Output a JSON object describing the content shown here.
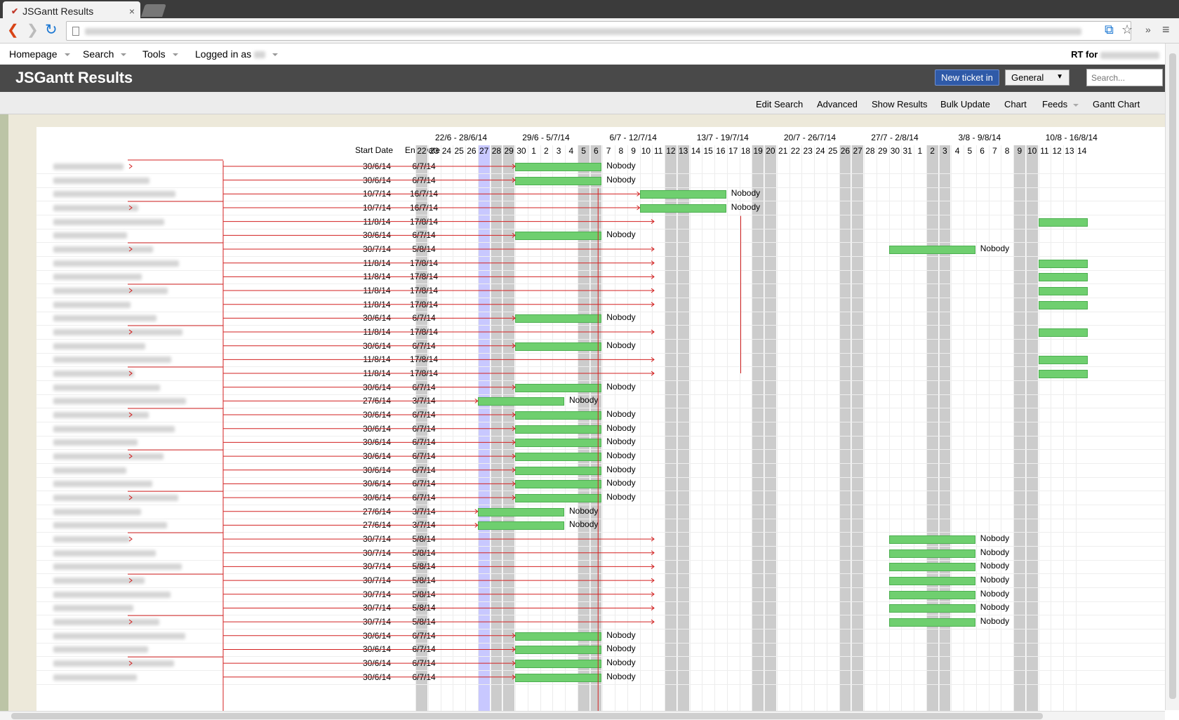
{
  "browser": {
    "tab_title": "JSGantt Results",
    "tab_close": "×"
  },
  "rt_menu": {
    "homepage": "Homepage",
    "search": "Search",
    "tools": "Tools",
    "logged_in": "Logged in as",
    "rt_for": "RT for"
  },
  "header": {
    "title": "JSGantt Results",
    "new_ticket": "New ticket in",
    "queue": "General",
    "search_placeholder": "Search..."
  },
  "page_menu": [
    "Edit Search",
    "Advanced",
    "Show Results",
    "Bulk Update",
    "Chart",
    "Feeds",
    "Gantt Chart"
  ],
  "gantt": {
    "start_header": "Start Date",
    "end_header": "End Date",
    "weeks": [
      "22/6 - 28/6/14",
      "29/6 - 5/7/14",
      "6/7 - 12/7/14",
      "13/7 - 19/7/14",
      "20/7 - 26/7/14",
      "27/7 - 2/8/14",
      "3/8 - 9/8/14",
      "10/8 - 16/8/14"
    ],
    "days": [
      "22",
      "23",
      "24",
      "25",
      "26",
      "27",
      "28",
      "29",
      "30",
      "1",
      "2",
      "3",
      "4",
      "5",
      "6",
      "7",
      "8",
      "9",
      "10",
      "11",
      "12",
      "13",
      "14",
      "15",
      "16",
      "17",
      "18",
      "19",
      "20",
      "21",
      "22",
      "23",
      "24",
      "25",
      "26",
      "27",
      "28",
      "29",
      "30",
      "31",
      "1",
      "2",
      "3",
      "4",
      "5",
      "6",
      "7",
      "8",
      "9",
      "10",
      "11",
      "12",
      "13",
      "14"
    ],
    "resource": "Nobody",
    "rows": [
      {
        "start": "30/6/14",
        "end": "6/7/14"
      },
      {
        "start": "30/6/14",
        "end": "6/7/14"
      },
      {
        "start": "10/7/14",
        "end": "16/7/14"
      },
      {
        "start": "10/7/14",
        "end": "16/7/14"
      },
      {
        "start": "11/8/14",
        "end": "17/8/14"
      },
      {
        "start": "30/6/14",
        "end": "6/7/14"
      },
      {
        "start": "30/7/14",
        "end": "5/8/14"
      },
      {
        "start": "11/8/14",
        "end": "17/8/14"
      },
      {
        "start": "11/8/14",
        "end": "17/8/14"
      },
      {
        "start": "11/8/14",
        "end": "17/8/14"
      },
      {
        "start": "11/8/14",
        "end": "17/8/14"
      },
      {
        "start": "30/6/14",
        "end": "6/7/14"
      },
      {
        "start": "11/8/14",
        "end": "17/8/14"
      },
      {
        "start": "30/6/14",
        "end": "6/7/14"
      },
      {
        "start": "11/8/14",
        "end": "17/8/14"
      },
      {
        "start": "11/8/14",
        "end": "17/8/14"
      },
      {
        "start": "30/6/14",
        "end": "6/7/14"
      },
      {
        "start": "27/6/14",
        "end": "3/7/14"
      },
      {
        "start": "30/6/14",
        "end": "6/7/14"
      },
      {
        "start": "30/6/14",
        "end": "6/7/14"
      },
      {
        "start": "30/6/14",
        "end": "6/7/14"
      },
      {
        "start": "30/6/14",
        "end": "6/7/14"
      },
      {
        "start": "30/6/14",
        "end": "6/7/14"
      },
      {
        "start": "30/6/14",
        "end": "6/7/14"
      },
      {
        "start": "30/6/14",
        "end": "6/7/14"
      },
      {
        "start": "27/6/14",
        "end": "3/7/14"
      },
      {
        "start": "27/6/14",
        "end": "3/7/14"
      },
      {
        "start": "30/7/14",
        "end": "5/8/14"
      },
      {
        "start": "30/7/14",
        "end": "5/8/14"
      },
      {
        "start": "30/7/14",
        "end": "5/8/14"
      },
      {
        "start": "30/7/14",
        "end": "5/8/14"
      },
      {
        "start": "30/7/14",
        "end": "5/8/14"
      },
      {
        "start": "30/7/14",
        "end": "5/8/14"
      },
      {
        "start": "30/7/14",
        "end": "5/8/14"
      },
      {
        "start": "30/6/14",
        "end": "6/7/14"
      },
      {
        "start": "30/6/14",
        "end": "6/7/14"
      },
      {
        "start": "30/6/14",
        "end": "6/7/14"
      },
      {
        "start": "30/6/14",
        "end": "6/7/14"
      }
    ]
  },
  "colors": {
    "bar": "#6fcf6f",
    "weekend": "#cccccc",
    "today": "#c8c8ff",
    "dependency": "#d32020",
    "header_bg": "#494949",
    "new_ticket": "#2f5aa8"
  }
}
